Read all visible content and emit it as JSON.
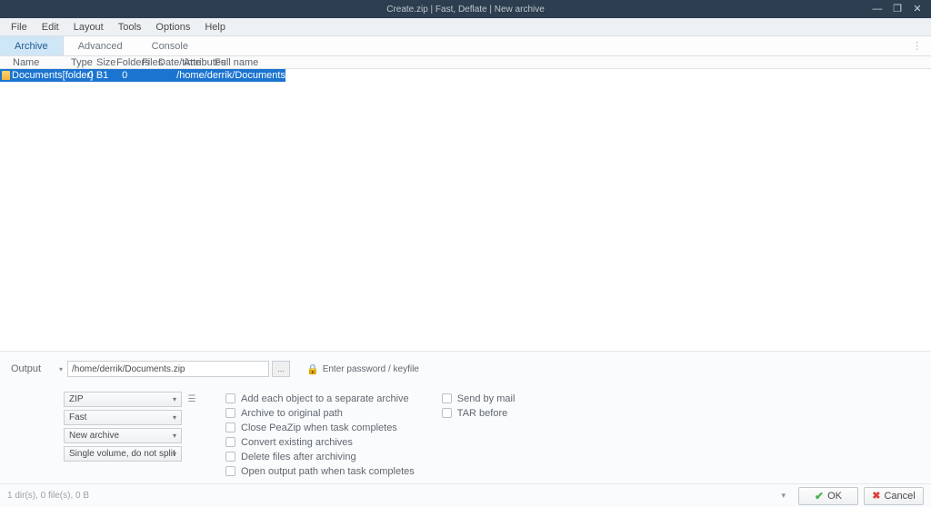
{
  "titlebar": {
    "title": "Create.zip | Fast, Deflate | New archive"
  },
  "menubar": {
    "items": [
      "File",
      "Edit",
      "Layout",
      "Tools",
      "Options",
      "Help"
    ]
  },
  "tabs": {
    "items": [
      "Archive",
      "Advanced",
      "Console"
    ],
    "active_index": 0
  },
  "columns": {
    "name": "Name",
    "type": "Type",
    "size": "Size",
    "folders": "Folders",
    "files": "Files",
    "datetime": "Date/time",
    "attributes": "Attributes",
    "fullname": "Full name"
  },
  "rows": [
    {
      "name": "Documents",
      "type": "[folder]",
      "size": "0 B",
      "folders": "1",
      "files": "0",
      "datetime": "",
      "attributes": "",
      "fullname": "/home/derrik/Documents"
    }
  ],
  "output": {
    "label": "Output",
    "value": "/home/derrik/Documents.zip",
    "browse": "...",
    "password_label": "Enter password / keyfile"
  },
  "dropdowns": {
    "format": "ZIP",
    "level": "Fast",
    "mode": "New archive",
    "split": "Single volume, do not split"
  },
  "checkboxes_left": [
    "Add each object to a separate archive",
    "Archive to original path",
    "Close PeaZip when task completes",
    "Convert existing archives",
    "Delete files after archiving",
    "Open output path when task completes"
  ],
  "checkboxes_right": [
    "Send by mail",
    "TAR before"
  ],
  "status": "1 dir(s), 0 file(s), 0 B",
  "buttons": {
    "ok": "OK",
    "cancel": "Cancel"
  }
}
